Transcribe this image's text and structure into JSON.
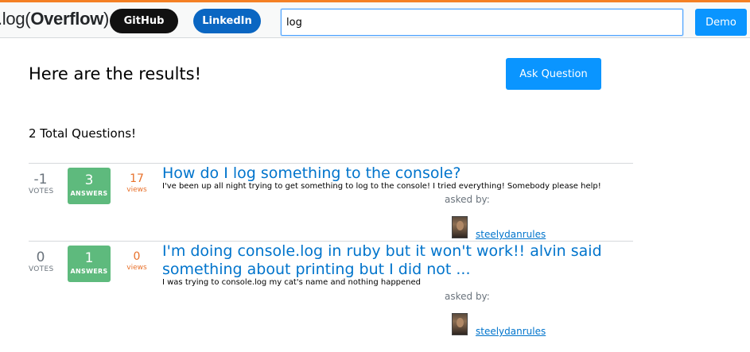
{
  "header": {
    "logo_prefix": ".log(",
    "logo_bold": "Overflow",
    "logo_suffix": ")",
    "github_label": "GitHub",
    "linkedin_label": "LinkedIn",
    "search_value": "log",
    "demo_label": "Demo"
  },
  "main": {
    "results_title": "Here are the results!",
    "ask_label": "Ask Question",
    "total_label": "2 Total Questions!"
  },
  "questions": [
    {
      "votes": "-1",
      "votes_label": "VOTES",
      "answers": "3",
      "answers_label": "ANSWERS",
      "views": "17",
      "views_label": "views",
      "title": "How do I log something to the console?",
      "excerpt": "I've been up all night trying to get something to log to the console! I tried everything! Somebody please help!",
      "asked_by_label": "asked by:",
      "author": "steelydanrules"
    },
    {
      "votes": "0",
      "votes_label": "VOTES",
      "answers": "1",
      "answers_label": "ANSWERS",
      "views": "0",
      "views_label": "views",
      "title": "I'm doing console.log in ruby but it won't work!! alvin said something about printing but I did not ...",
      "excerpt": "I was trying to console.log my cat's name and nothing happened",
      "asked_by_label": "asked by:",
      "author": "steelydanrules"
    }
  ],
  "colors": {
    "accent": "#f48024",
    "primary_button": "#0a95ff",
    "answered": "#5eba7d",
    "link": "#0074cc",
    "views": "#e8712b"
  }
}
